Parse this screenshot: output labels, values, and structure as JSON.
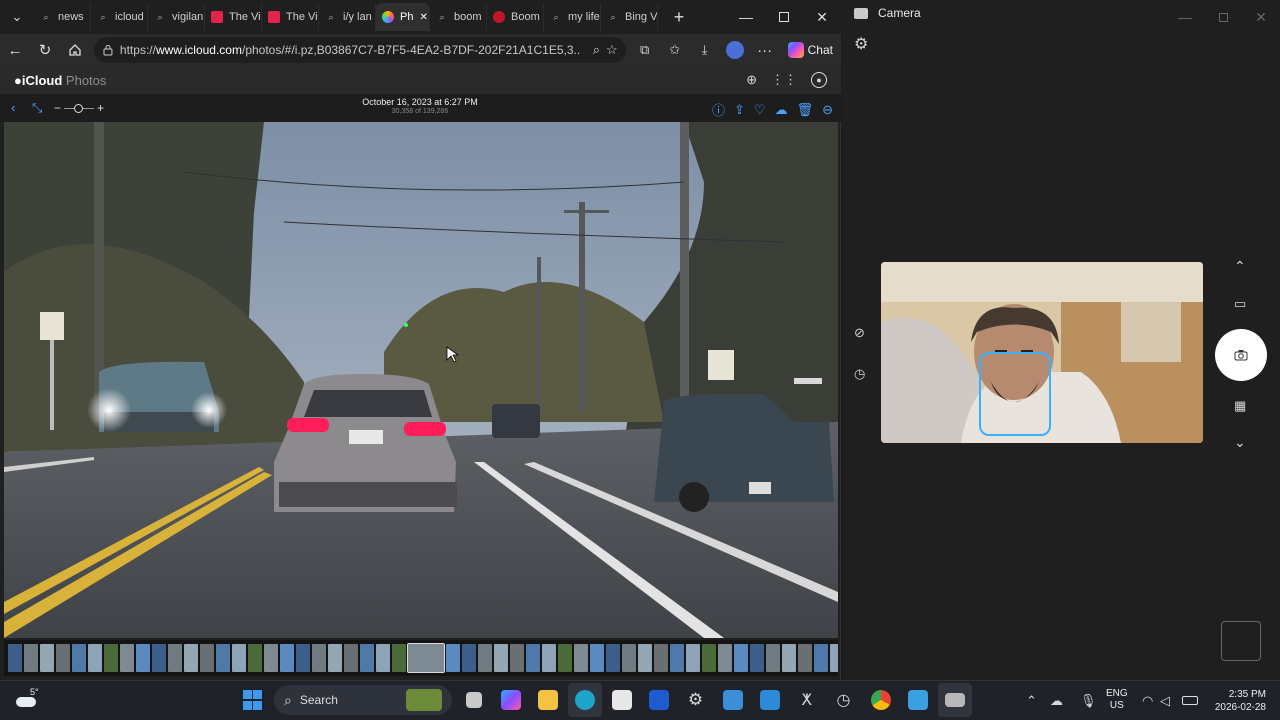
{
  "browser": {
    "tabs": [
      {
        "label": "news",
        "icon": "search-icon"
      },
      {
        "label": "icloud",
        "icon": "search-icon"
      },
      {
        "label": "vigilan",
        "icon": "search-icon"
      },
      {
        "label": "The Vi",
        "icon": "verge-icon"
      },
      {
        "label": "The Vi",
        "icon": "verge-icon"
      },
      {
        "label": "i/y lan",
        "icon": "search-icon"
      },
      {
        "label": "Ph",
        "icon": "photos-icon",
        "active": true
      },
      {
        "label": "boom",
        "icon": "search-icon"
      },
      {
        "label": "Boom",
        "icon": "boom-icon"
      },
      {
        "label": "my life",
        "icon": "search-icon"
      },
      {
        "label": "Bing V",
        "icon": "search-icon"
      }
    ],
    "url_prefix": "https://",
    "url_domain": "www.icloud.com",
    "url_rest": "/photos/#/i.pz,B03867C7-B7F5-4EA2-B7DF-202F21A1C1E5,3...",
    "chat_label": "Chat"
  },
  "icloud": {
    "brand": "iCloud",
    "app": "Photos",
    "photo_date": "October 16, 2023 at 6:27 PM",
    "photo_count": "30,358 of 139,286"
  },
  "camera": {
    "title": "Camera"
  },
  "taskbar": {
    "weather": "5°",
    "search_label": "Search",
    "lang_line1": "ENG",
    "lang_line2": "US",
    "time": "2:35 PM",
    "date": "2026-02-28"
  },
  "colors": {
    "accent": "#0078d4",
    "face_box": "#3ab0ff",
    "tail_light": "#ff1e5a"
  }
}
